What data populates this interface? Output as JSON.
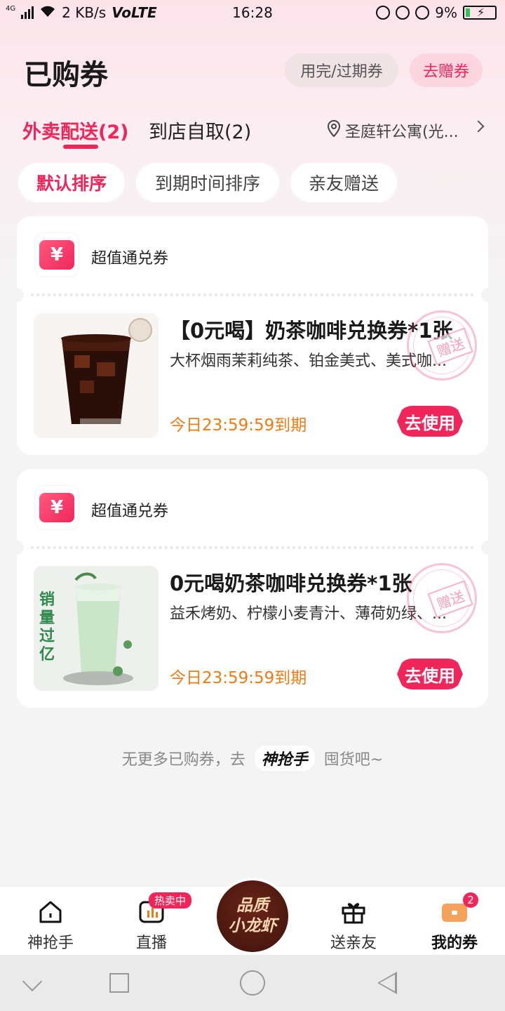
{
  "status_bar": {
    "network_small": "4G",
    "speed": "2 KB/s",
    "volte": "VoLTE",
    "time": "16:28",
    "battery": "9%"
  },
  "header": {
    "title": "已购券",
    "expired_button": "用完/过期券",
    "gift_button": "去赠券"
  },
  "tabs": [
    {
      "label": "外卖配送(2)",
      "active": true
    },
    {
      "label": "到店自取(2)",
      "active": false
    }
  ],
  "location": {
    "text": "圣庭轩公寓(光...",
    "icon": "location-pin-icon"
  },
  "sort_options": [
    {
      "label": "默认排序",
      "active": true
    },
    {
      "label": "到期时间排序",
      "active": false
    },
    {
      "label": "亲友赠送",
      "active": false
    }
  ],
  "coupons": [
    {
      "type_label": "超值通兑券",
      "name": "【0元喝】奶茶咖啡兑换券*1张",
      "description": "大杯烟雨茉莉纯茶、铂金美式、美式咖...",
      "expire": "今日23:59:59到期",
      "use_button": "去使用",
      "stamp": "赠送",
      "image_icon": "iced-coffee-cup"
    },
    {
      "type_label": "超值通兑券",
      "name": "0元喝奶茶咖啡兑换券*1张",
      "description": "益禾烤奶、柠檬小麦青汁、薄荷奶绿、...",
      "expire": "今日23:59:59到期",
      "use_button": "去使用",
      "stamp": "赠送",
      "image_icon": "mint-milk-tea-cup",
      "image_text": "销量过亿"
    }
  ],
  "footer_note": {
    "before": "无更多已购券，去",
    "brand": "神抢手",
    "after": "囤货吧~"
  },
  "bottom_nav": [
    {
      "label": "神抢手",
      "icon": "home-icon",
      "active": false
    },
    {
      "label": "直播",
      "icon": "live-icon",
      "badge": "热卖中",
      "active": false
    },
    {
      "label": "品质小龙虾",
      "icon": "center-promo",
      "active": false
    },
    {
      "label": "送亲友",
      "icon": "gift-icon",
      "active": false
    },
    {
      "label": "我的券",
      "icon": "coupon-icon",
      "badge": "2",
      "active": true
    }
  ],
  "center_promo": {
    "line1": "品质",
    "line2": "小龙虾"
  },
  "colors": {
    "accent": "#f0265b",
    "expire": "#f37a12",
    "promo_bg": "#3d130c"
  }
}
